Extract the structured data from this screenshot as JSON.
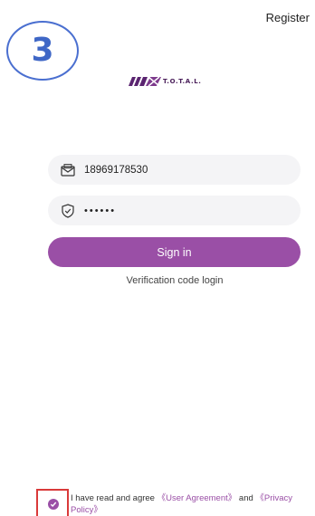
{
  "header": {
    "register_label": "Register"
  },
  "overlay": {
    "step_number": "3"
  },
  "logo": {
    "text": "T.O.T.A.L."
  },
  "login": {
    "phone_value": "18969178530",
    "password_masked": "••••••",
    "signin_label": "Sign in",
    "verification_label": "Verification code login"
  },
  "agreement": {
    "prefix": "I have read and agree ",
    "user_agreement": "《User Agreement》",
    "and": " and ",
    "privacy_policy": "《Privacy Policy》"
  },
  "colors": {
    "accent": "#9a4fa6",
    "badge": "#3f67c6",
    "highlight": "#d93a3a",
    "field_bg": "#f4f4f6"
  },
  "icons": [
    "envelope-icon",
    "shield-check-icon",
    "check-icon"
  ]
}
